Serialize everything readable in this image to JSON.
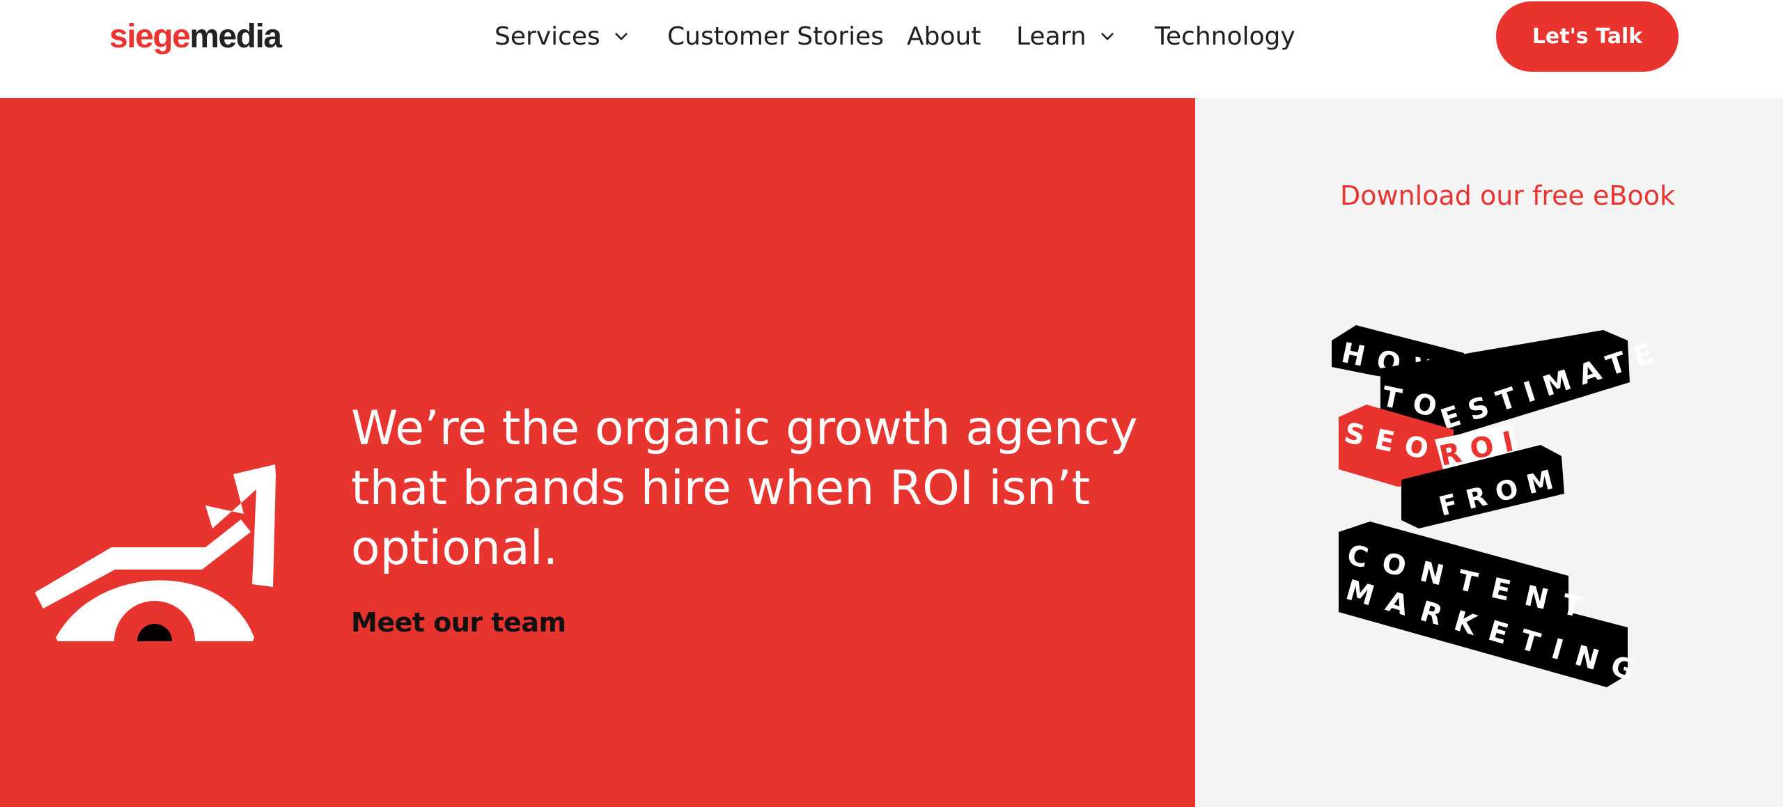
{
  "brand": {
    "logo_part1": "siege",
    "logo_part2": "media",
    "accent_color": "#e8332f",
    "text_color": "#222222"
  },
  "nav": {
    "items": [
      {
        "label": "Services",
        "has_dropdown": true,
        "icon": "chevron-down-icon"
      },
      {
        "label": "Customer Stories",
        "has_dropdown": false
      },
      {
        "label": "About",
        "has_dropdown": false
      },
      {
        "label": "Learn",
        "has_dropdown": true,
        "icon": "chevron-down-icon"
      },
      {
        "label": "Technology",
        "has_dropdown": false
      }
    ],
    "cta_label": "Let's Talk"
  },
  "hero": {
    "background_color": "#e8342f",
    "illustration": "eye-growth-arrow-icon",
    "headline": "We’re the organic growth agency that brands hire when ROI isn’t optional.",
    "link_label": "Meet our team"
  },
  "sidebar": {
    "background_color": "#f4f4f4",
    "ebook_link": "Download our free eBook",
    "ebook_cover": {
      "icon": "ebook-cover-illustration",
      "line1": "HOW",
      "line2a": "TO",
      "line2b": "ESTIMATE",
      "line3a": "SEO",
      "line3b": "ROI",
      "line4": "FROM",
      "line5": "CONTENT",
      "line6": "MARKETING"
    }
  }
}
